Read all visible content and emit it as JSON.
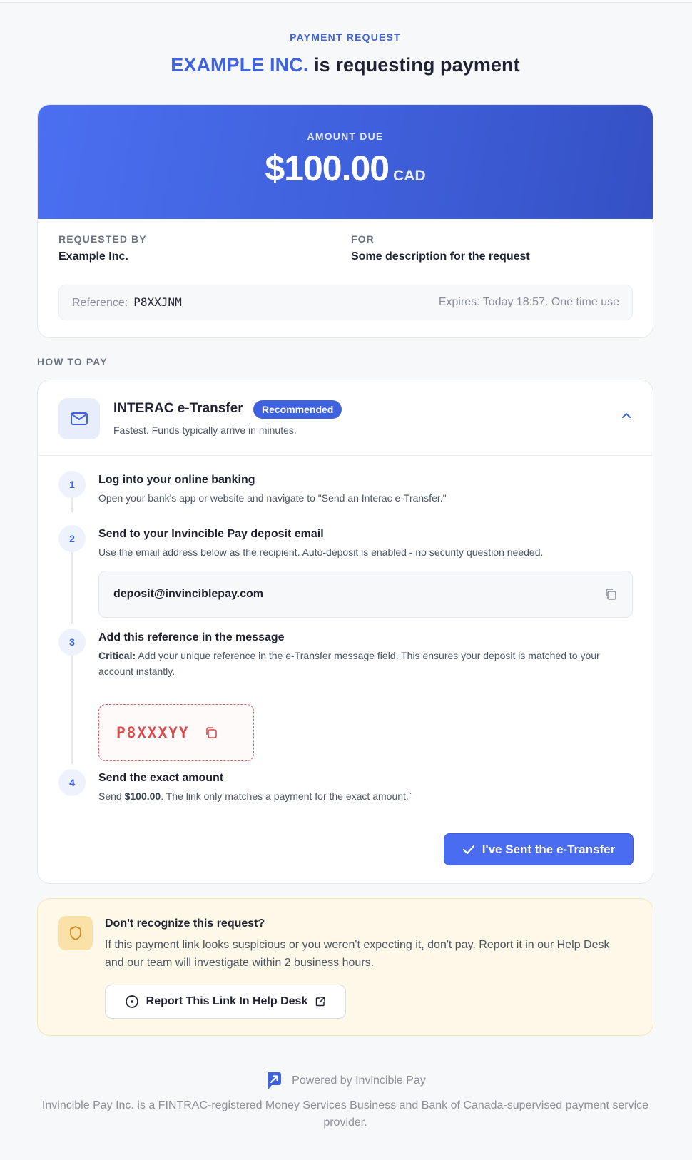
{
  "header": {
    "eyebrow": "PAYMENT REQUEST",
    "merchant": "EXAMPLE INC.",
    "headline_rest": " is requesting payment"
  },
  "amount": {
    "label": "AMOUNT DUE",
    "value": "$100.00",
    "currency": "CAD"
  },
  "details": {
    "requested_by_label": "REQUESTED BY",
    "requested_by_value": "Example Inc.",
    "for_label": "FOR",
    "for_value": "Some description for the request",
    "reference_label": "Reference:",
    "reference_code": "P8XXJNM",
    "expires": "Expires: Today 18:57. One time use"
  },
  "how_to_pay": {
    "section_title": "HOW TO PAY",
    "method_title": "INTERAC e-Transfer",
    "badge": "Recommended",
    "method_subtitle": "Fastest. Funds typically arrive in minutes.",
    "steps": [
      {
        "num": "1",
        "title": "Log into your online banking",
        "desc": "Open your bank's app or website and navigate to \"Send an Interac e-Transfer.\""
      },
      {
        "num": "2",
        "title": "Send to your Invincible Pay deposit email",
        "desc": "Use the email address below as the recipient. Auto-deposit is enabled - no security question needed."
      },
      {
        "num": "3",
        "title": "Add this reference in the message",
        "desc_bold": "Critical:",
        "desc": " Add your unique reference in the e-Transfer message field. This ensures your deposit is matched to your account instantly."
      },
      {
        "num": "4",
        "title": "Send the exact amount",
        "desc_pre": "Send ",
        "desc_bold": "$100.00",
        "desc_post": ". The link only matches a payment for the exact amount.`"
      }
    ],
    "deposit_email": "deposit@invinciblepay.com",
    "message_reference": "P8XXXYY",
    "confirm_button": "I've Sent the e-Transfer"
  },
  "warning": {
    "title": "Don't recognize this request?",
    "text": "If this payment link looks suspicious or you weren't expecting it, don't pay. Report it in our Help Desk and our team will investigate within 2 business hours.",
    "button": "Report This Link In Help Desk"
  },
  "footer": {
    "powered": "Powered by Invincible Pay",
    "disclaimer": "Invincible Pay Inc. is a FINTRAC-registered Money Services Business and Bank of Canada-supervised payment service provider."
  },
  "colors": {
    "accent": "#3f63e0",
    "danger": "#dc4b4b",
    "warning_bg": "#fdf8e8"
  }
}
